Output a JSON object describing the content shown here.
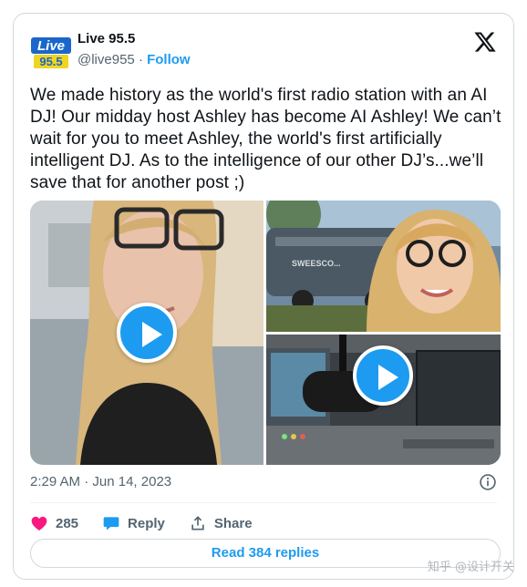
{
  "account": {
    "name": "Live 95.5",
    "handle": "@live955",
    "separator": "·",
    "follow_label": "Follow",
    "logo_text_top": "Live",
    "logo_text_bottom": "95.5"
  },
  "tweet": {
    "text": "We made history as the world's first radio station with an AI DJ! Our midday host Ashley has become AI Ashley! We can’t wait for you to meet Ashley, the world's first artificially intelligent DJ. As to the intelligence of our other DJ’s...we’ll save that for another post ;)",
    "time": "2:29 AM",
    "date_separator": "·",
    "date": "Jun 14, 2023"
  },
  "media": {
    "tiles": [
      {
        "name": "video-ashley-selfie",
        "has_play": true
      },
      {
        "name": "image-ai-ashley",
        "has_play": false
      },
      {
        "name": "video-studio-microphone",
        "has_play": true
      }
    ],
    "bus_sign": "SWEESCO..."
  },
  "actions": {
    "like_count": "285",
    "reply_label": "Reply",
    "share_label": "Share"
  },
  "replies_button": "Read 384 replies",
  "watermark": "知乎 @设计开关",
  "colors": {
    "accent": "#1d9bf0",
    "like": "#f91880",
    "text": "#0f1419",
    "muted": "#536471",
    "border": "#cfd9de"
  },
  "icons": [
    "x-logo-icon",
    "info-icon",
    "heart-icon",
    "reply-bubble-icon",
    "share-icon",
    "play-icon"
  ]
}
